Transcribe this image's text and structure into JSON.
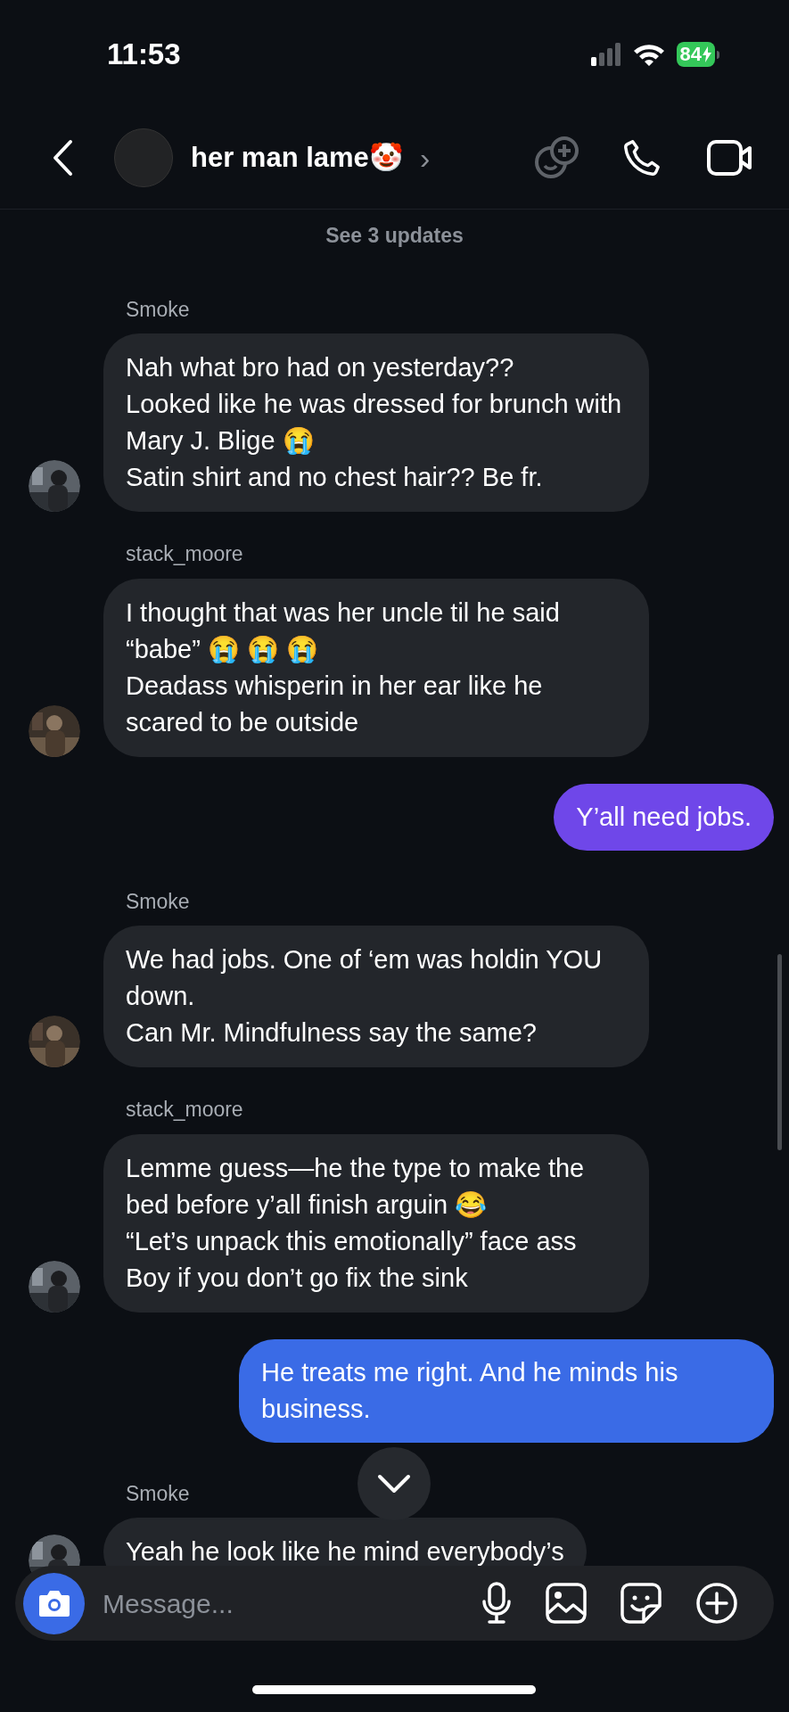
{
  "status_bar": {
    "time": "11:53",
    "battery": "84"
  },
  "header": {
    "title": "her man lame🤡",
    "chevron": "›"
  },
  "updates_link": "See 3 updates",
  "messages": [
    {
      "kind": "incoming",
      "sender": "Smoke",
      "text": "Nah what bro had on yesterday??\nLooked like he was dressed for brunch with Mary J. Blige 😭\nSatin shirt and no chest hair?? Be fr."
    },
    {
      "kind": "incoming",
      "sender": "stack_moore",
      "text": "I thought that was her uncle til he said “babe” 😭 😭 😭\nDeadass whisperin in her ear like he scared to be outside"
    },
    {
      "kind": "outgoing",
      "color": "#6f47e9",
      "text": "Y’all need jobs."
    },
    {
      "kind": "incoming",
      "sender": "Smoke",
      "text": "We had jobs. One of ‘em was holdin YOU down.\nCan Mr. Mindfulness say the same?"
    },
    {
      "kind": "incoming",
      "sender": "stack_moore",
      "text": "Lemme guess—he the type to make the bed before y’all finish arguin 😂\n“Let’s unpack this emotionally” face ass\nBoy if you don’t go fix the sink"
    },
    {
      "kind": "outgoing",
      "color": "#3a6be6",
      "text": "He treats me right. And he minds his business."
    },
    {
      "kind": "incoming",
      "sender": "Smoke",
      "text": "Yeah he look like he mind everybody’s"
    }
  ],
  "composer": {
    "placeholder": "Message..."
  }
}
